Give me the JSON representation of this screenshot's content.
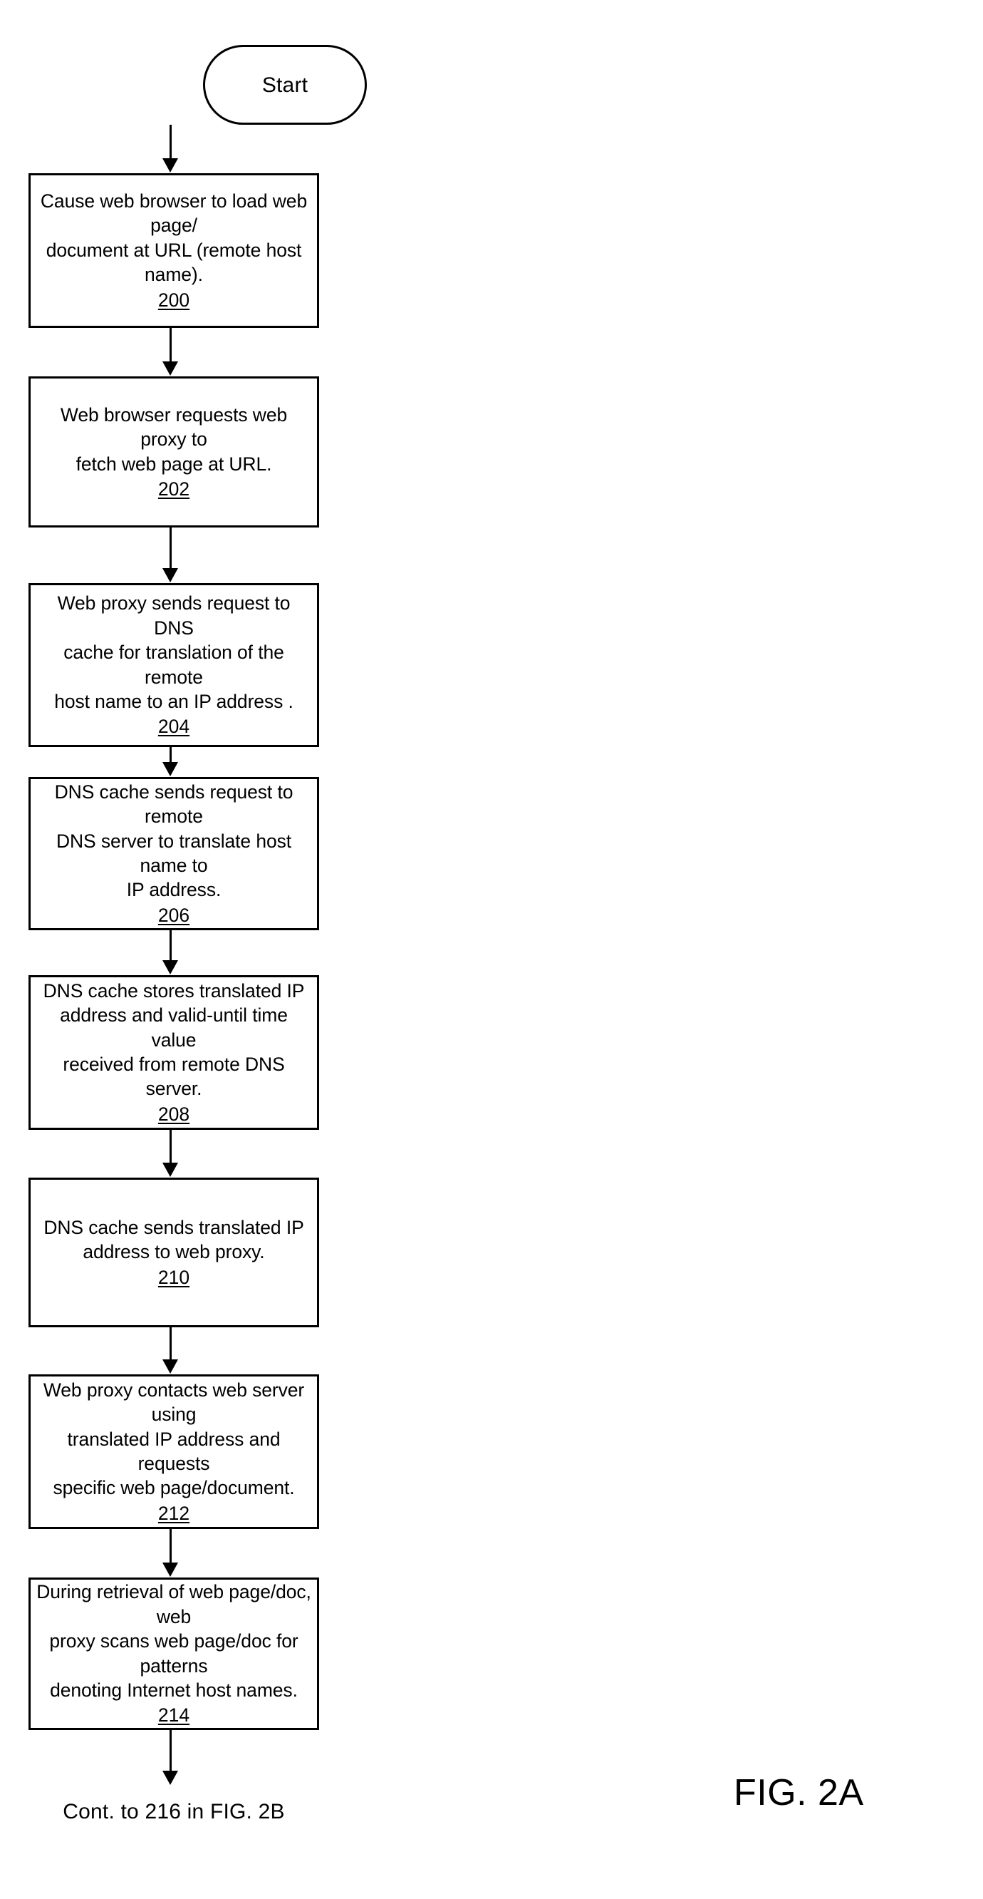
{
  "figure": {
    "label": "FIG. 2A",
    "continuation": "Cont. to 216 in FIG. 2B",
    "start_label": "Start",
    "ink_color": "#000000",
    "background_color": "#ffffff"
  },
  "steps": [
    {
      "ref": "200",
      "text": "Cause web browser to load web page/\ndocument at URL (remote host name)."
    },
    {
      "ref": "202",
      "text": "Web browser requests web proxy to\nfetch web page at URL."
    },
    {
      "ref": "204",
      "text": "Web proxy sends request to DNS\ncache for translation of the  remote\nhost name to an IP address ."
    },
    {
      "ref": "206",
      "text": "DNS cache sends request to remote\nDNS server to translate host name to\nIP address."
    },
    {
      "ref": "208",
      "text": "DNS cache stores translated IP\naddress and valid-until time value\nreceived from remote DNS server."
    },
    {
      "ref": "210",
      "text": "DNS cache sends translated IP\naddress to web proxy."
    },
    {
      "ref": "212",
      "text": "Web proxy contacts web server using\ntranslated IP address and requests\nspecific web page/document."
    },
    {
      "ref": "214",
      "text": "During retrieval of web page/doc, web\nproxy scans web page/doc for patterns\ndenoting Internet host names."
    }
  ]
}
